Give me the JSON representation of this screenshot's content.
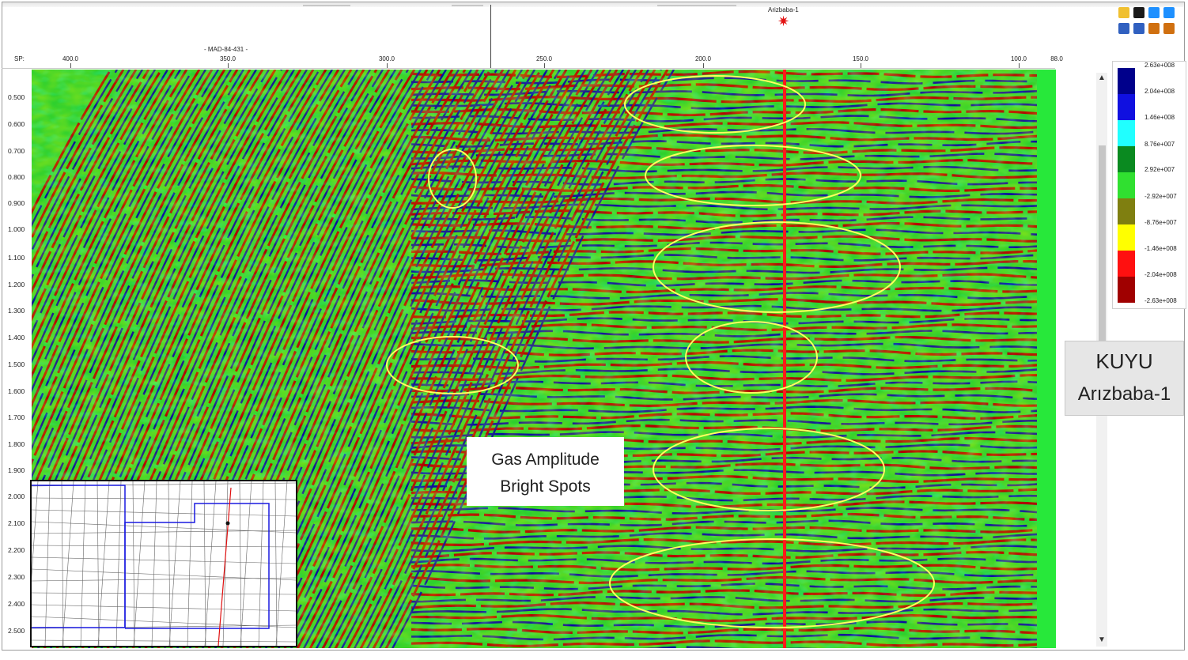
{
  "header": {
    "sp_label": "SP:",
    "line_label": "- MAD-84-431 -",
    "well_name": "Arizbaba-1",
    "well_symbol": "✷",
    "sp_ticks": [
      "400.0",
      "350.0",
      "300.0",
      "250.0",
      "200.0",
      "150.0",
      "100.0",
      "88.0"
    ]
  },
  "time_axis": {
    "labels": [
      "0.500",
      "0.600",
      "0.700",
      "0.800",
      "0.900",
      "1.000",
      "1.100",
      "1.200",
      "1.300",
      "1.400",
      "1.500",
      "1.600",
      "1.700",
      "1.800",
      "1.900",
      "2.000",
      "2.100",
      "2.200",
      "2.300",
      "2.400",
      "2.500"
    ]
  },
  "legend": {
    "labels": [
      "2.63e+008",
      "2.04e+008",
      "1.46e+008",
      "8.76e+007",
      "2.92e+007",
      "-2.92e+007",
      "-8.76e+007",
      "-1.46e+008",
      "-2.04e+008",
      "-2.63e+008"
    ],
    "colors": [
      "#00008b",
      "#1010e0",
      "#20ffff",
      "#0a8a20",
      "#30e030",
      "#7f7f10",
      "#ffff00",
      "#ff1010",
      "#a00000",
      "#600000"
    ]
  },
  "toolbar": {
    "icons": [
      "open-folder-icon",
      "save-icon",
      "back-arrow-icon",
      "forward-arrow-icon",
      "refresh-icon",
      "undo-icon",
      "sort-down-icon",
      "sort-up-icon"
    ],
    "colors": [
      "#f0c030",
      "#1a1a1a",
      "#1e90ff",
      "#1e90ff",
      "#3060c0",
      "#3060c0",
      "#d07010",
      "#d07010"
    ]
  },
  "well_panel": {
    "title": "KUYU",
    "subtitle": "Arızbaba-1"
  },
  "callout": {
    "line1": "Gas Amplitude",
    "line2": "Bright Spots"
  },
  "colors": {
    "seismic_red": "#b00000",
    "seismic_blue": "#0a0aa0",
    "seismic_green": "#2ed02e",
    "seismic_yellow": "#ffff00",
    "ellipse": "#ffff60",
    "well_track": "#ff1a1a",
    "map_boundary": "#1a1ae0",
    "map_line": "#e01010"
  }
}
